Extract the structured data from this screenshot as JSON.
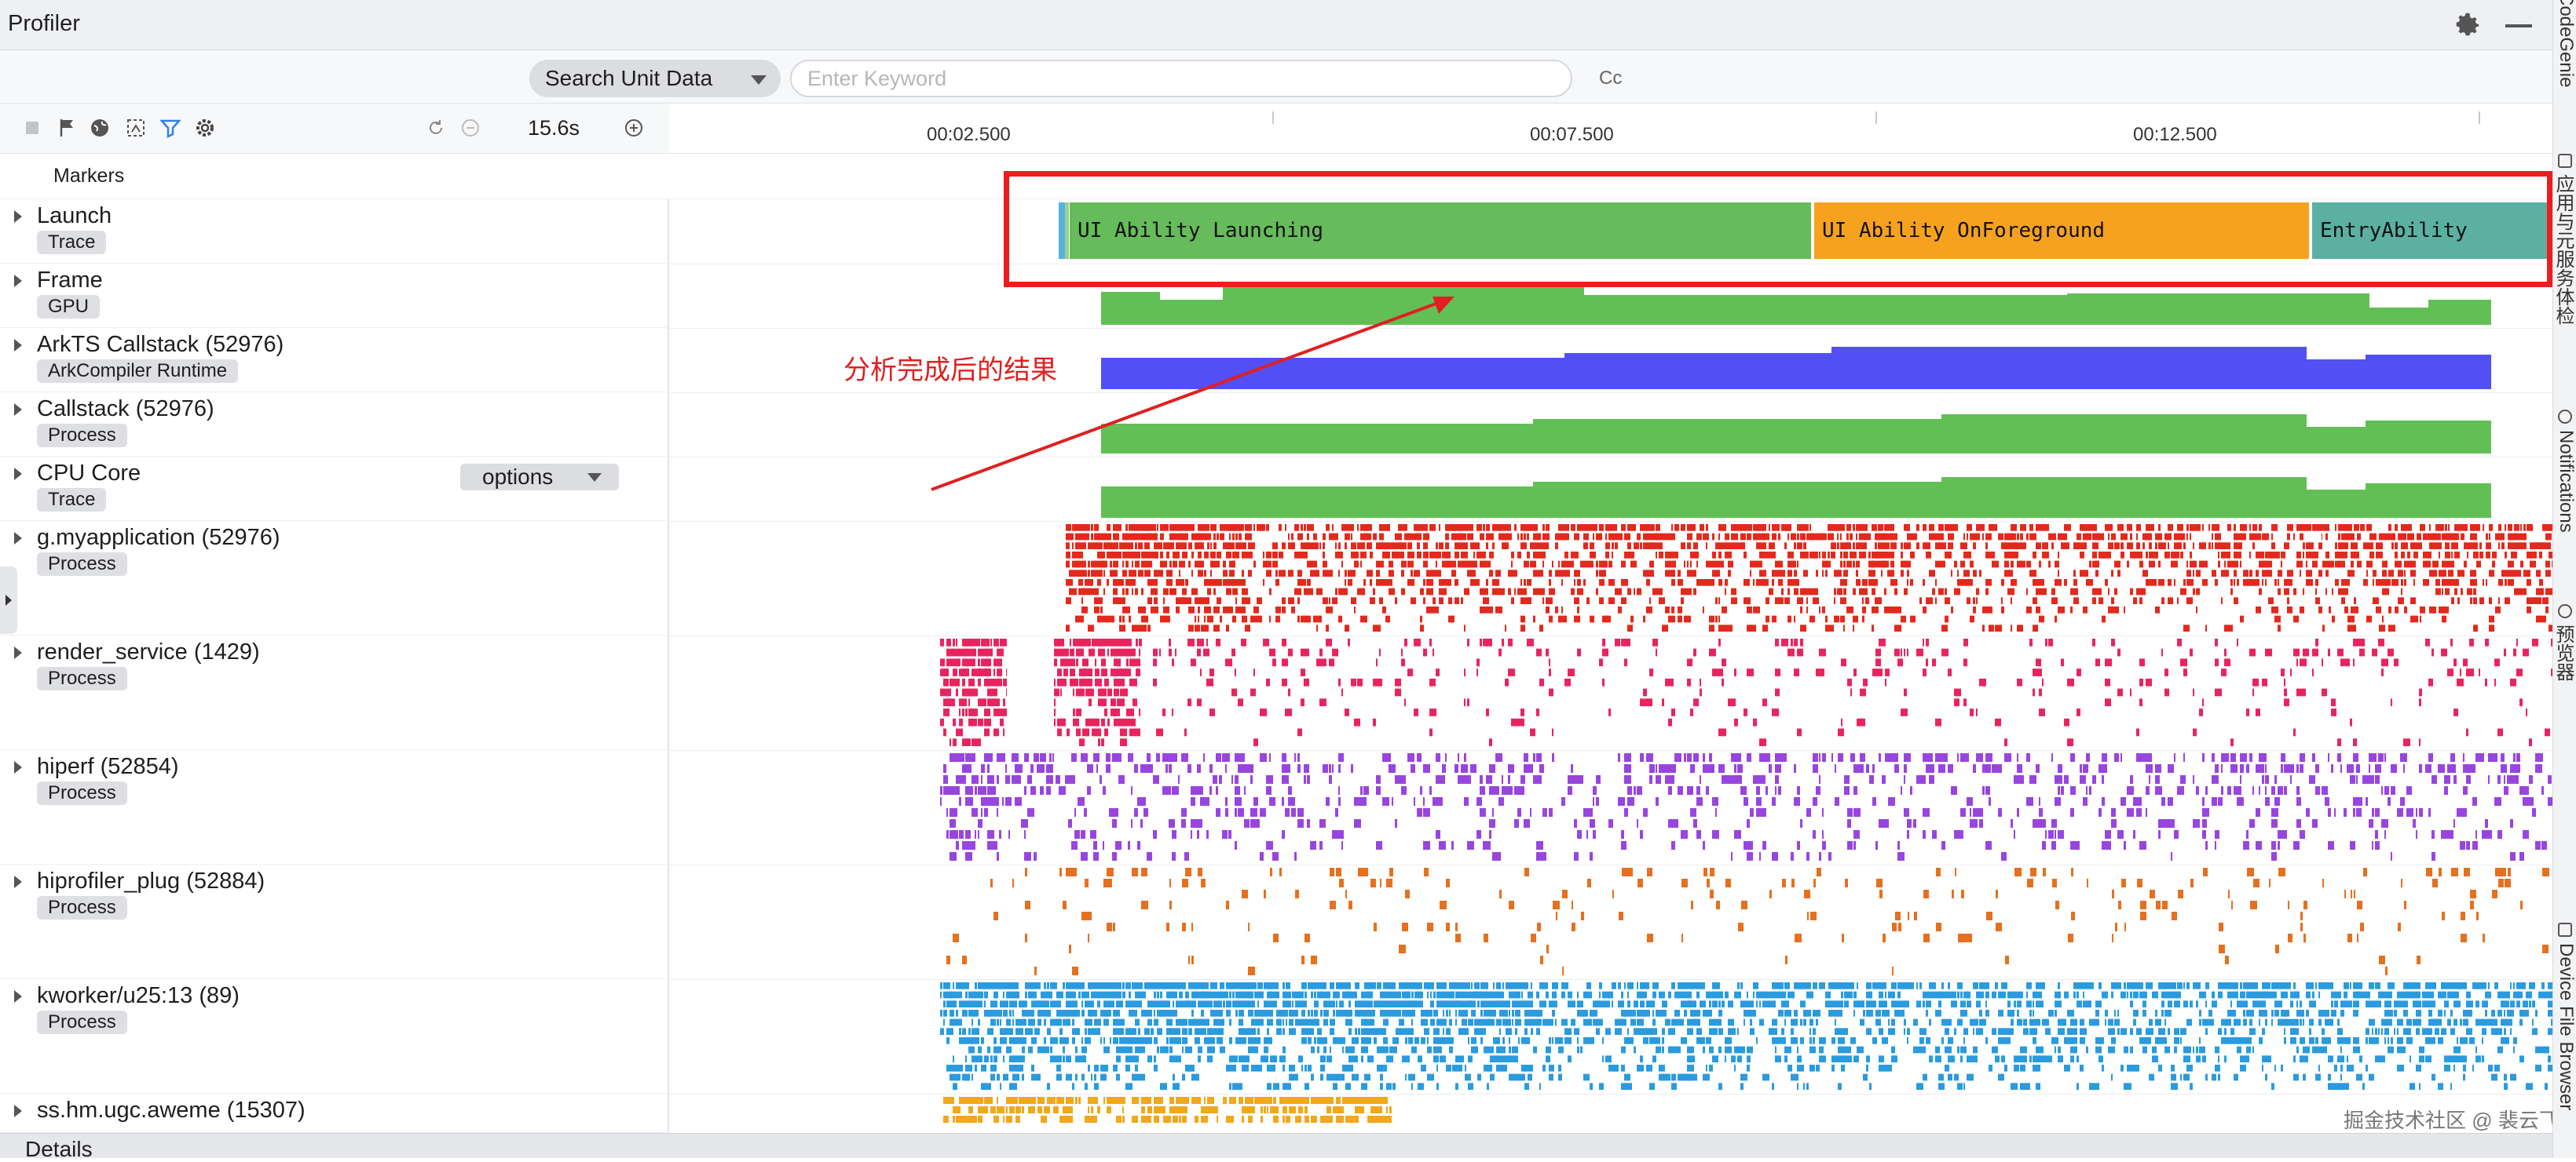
{
  "window": {
    "title": "Profiler"
  },
  "search": {
    "scope_label": "Search Unit Data",
    "placeholder": "Enter Keyword",
    "case_label": "Cc"
  },
  "toolbar": {
    "duration": "15.6s"
  },
  "ruler": {
    "ticks": [
      "00:02.500",
      "00:07.500",
      "00:12.500"
    ]
  },
  "markers_label": "Markers",
  "tracks": [
    {
      "name": "Launch",
      "tag": "Trace"
    },
    {
      "name": "Frame",
      "tag": "GPU"
    },
    {
      "name": "ArkTS Callstack (52976)",
      "tag": "ArkCompiler Runtime"
    },
    {
      "name": "Callstack (52976)",
      "tag": "Process"
    },
    {
      "name": "CPU Core",
      "tag": "Trace"
    },
    {
      "name": "g.myapplication (52976)",
      "tag": "Process"
    },
    {
      "name": "render_service (1429)",
      "tag": "Process"
    },
    {
      "name": "hiperf (52854)",
      "tag": "Process"
    },
    {
      "name": "hiprofiler_plug (52884)",
      "tag": "Process"
    },
    {
      "name": "kworker/u25:13 (89)",
      "tag": "Process"
    },
    {
      "name": "ss.hm.ugc.aweme (15307)",
      "tag": ""
    }
  ],
  "options_label": "options",
  "launch_segments": [
    {
      "label": "UI Ability Launching",
      "color": "#66bb5a"
    },
    {
      "label": "UI Ability OnForeground",
      "color": "#f6a21e"
    },
    {
      "label": "EntryAbility",
      "color": "#5bb0a2"
    }
  ],
  "annotation": "分析完成后的结果",
  "details_label": "Details",
  "watermark": "掘金技术社区 @ 裴云飞",
  "right_tabs": [
    "CodeGenie",
    "应用与元服务体检",
    "Notifications",
    "预览器",
    "Device File Browser"
  ],
  "colors": {
    "frame": "#62bf55",
    "arkts": "#5250f5",
    "callstack": "#62bf55",
    "cpu": "#62bf55",
    "myapp": "#e3291d",
    "render": "#e8245f",
    "hiperf": "#9845e0",
    "hiprofiler": "#e5701f",
    "kworker": "#2a9bde",
    "aweme": "#f0a81c",
    "highlight": "#ee1d1d"
  }
}
